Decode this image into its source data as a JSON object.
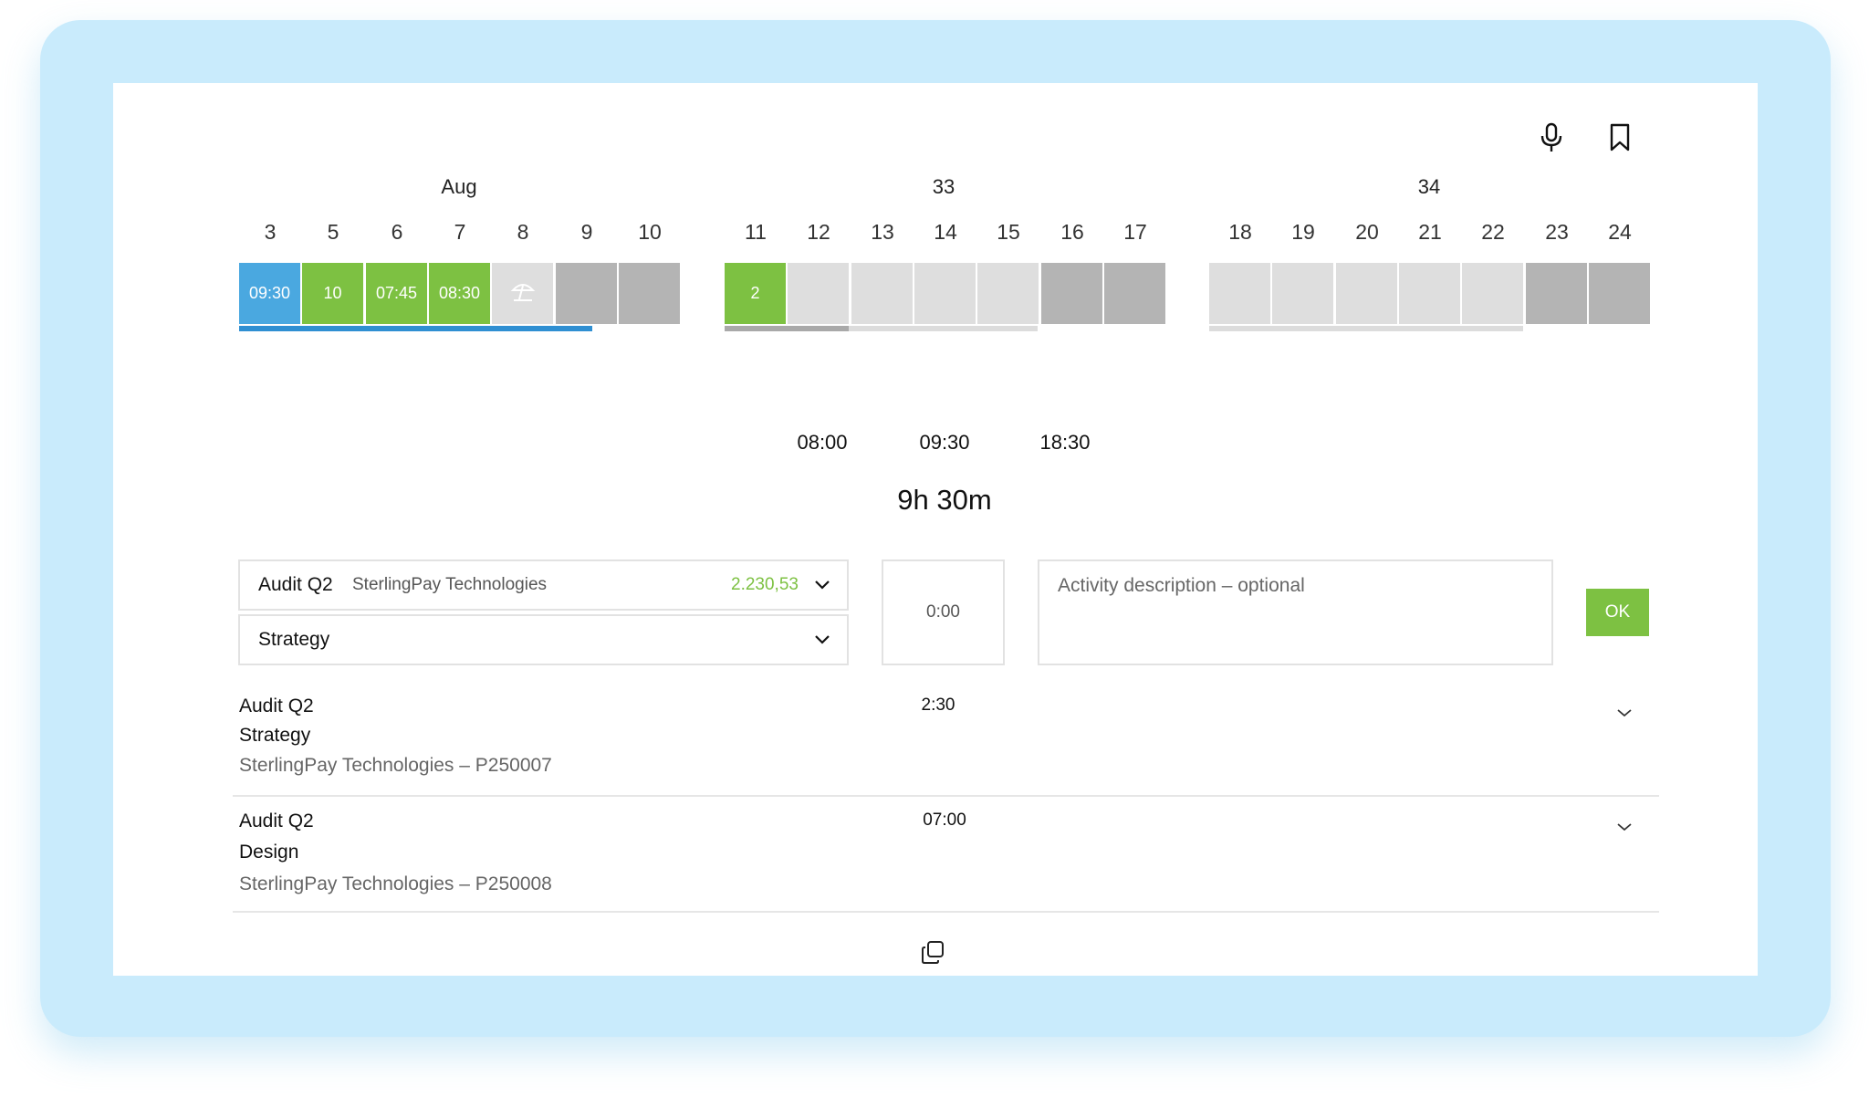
{
  "header": {
    "mic_icon": "microphone-icon",
    "bookmark_icon": "bookmark-icon"
  },
  "calendar": {
    "week_labels": [
      "Aug",
      "33",
      "34"
    ],
    "week1": {
      "days": [
        {
          "num": "3",
          "value": "09:30",
          "state": "selected"
        },
        {
          "num": "5",
          "value": "10",
          "state": "filled"
        },
        {
          "num": "6",
          "value": "07:45",
          "state": "filled"
        },
        {
          "num": "7",
          "value": "08:30",
          "state": "filled"
        },
        {
          "num": "8",
          "value": "",
          "state": "vacation"
        },
        {
          "num": "9",
          "value": "",
          "state": "weekend"
        },
        {
          "num": "10",
          "value": "",
          "state": "weekend"
        }
      ]
    },
    "week2": {
      "days": [
        {
          "num": "11",
          "value": "2",
          "state": "filled"
        },
        {
          "num": "12",
          "value": "",
          "state": "empty"
        },
        {
          "num": "13",
          "value": "",
          "state": "empty"
        },
        {
          "num": "14",
          "value": "",
          "state": "empty"
        },
        {
          "num": "15",
          "value": "",
          "state": "empty"
        },
        {
          "num": "16",
          "value": "",
          "state": "weekend"
        },
        {
          "num": "17",
          "value": "",
          "state": "weekend"
        }
      ]
    },
    "week3": {
      "days": [
        {
          "num": "18",
          "value": "",
          "state": "empty"
        },
        {
          "num": "19",
          "value": "",
          "state": "empty"
        },
        {
          "num": "20",
          "value": "",
          "state": "empty"
        },
        {
          "num": "21",
          "value": "",
          "state": "empty"
        },
        {
          "num": "22",
          "value": "",
          "state": "empty"
        },
        {
          "num": "23",
          "value": "",
          "state": "weekend"
        },
        {
          "num": "24",
          "value": "",
          "state": "weekend"
        }
      ]
    },
    "colors": {
      "selected": "#4aa8e0",
      "filled": "#7dc142",
      "empty": "#dedede",
      "vacation": "#dedede",
      "weekend": "#b4b4b4"
    }
  },
  "timeline": {
    "start": "08:00",
    "mid": "09:30",
    "end": "18:30",
    "total": "9h 30m"
  },
  "form": {
    "project_name": "Audit Q2",
    "client_name": "SterlingPay Technologies",
    "budget": "2.230,53",
    "activity": "Strategy",
    "duration": "0:00",
    "description_placeholder": "Activity description – optional",
    "ok_label": "OK"
  },
  "entries": [
    {
      "project": "Audit Q2",
      "activity": "Strategy",
      "client": "SterlingPay Technologies – P250007",
      "time": "2:30"
    },
    {
      "project": "Audit Q2",
      "activity": "Design",
      "client": "SterlingPay Technologies – P250008",
      "time": "07:00"
    }
  ],
  "footer": {
    "copy_icon": "copy-icon"
  }
}
